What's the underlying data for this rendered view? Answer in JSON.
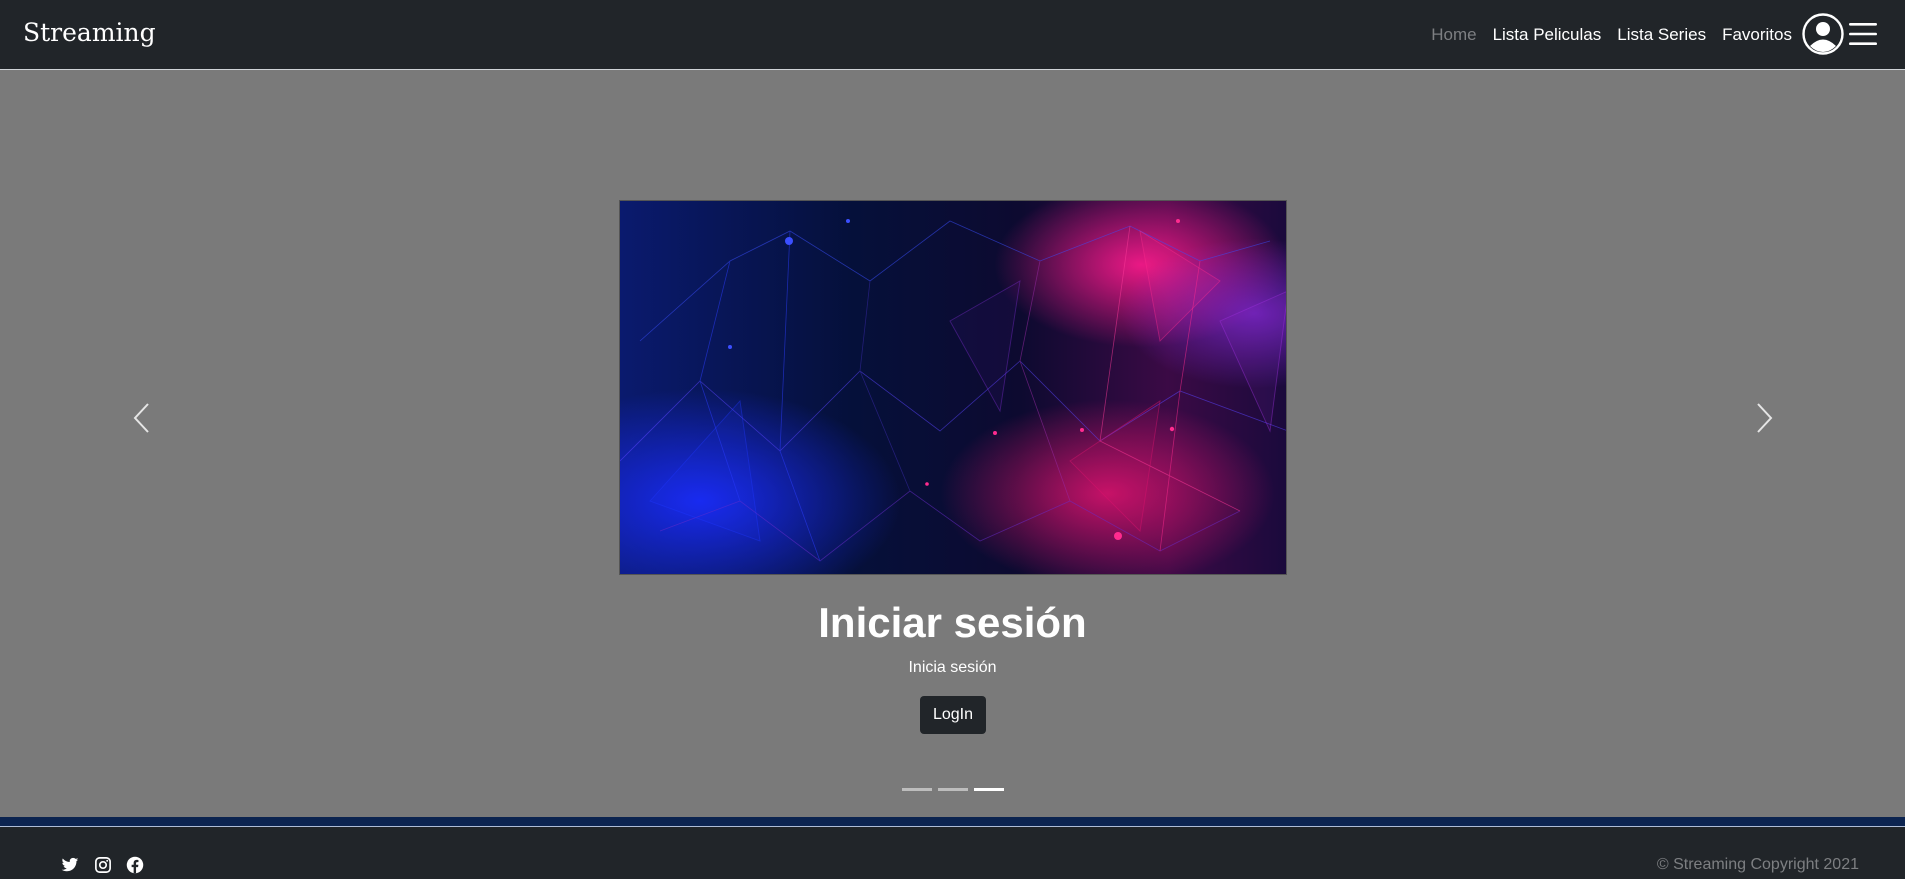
{
  "brand": "Streaming",
  "nav": {
    "items": [
      {
        "label": "Home",
        "active": true
      },
      {
        "label": "Lista Peliculas",
        "active": false
      },
      {
        "label": "Lista Series",
        "active": false
      },
      {
        "label": "Favoritos",
        "active": false
      }
    ],
    "user_icon": "user-circle-icon",
    "menu_icon": "hamburger-menu-icon"
  },
  "carousel": {
    "slide": {
      "title": "Iniciar sesión",
      "subtitle": "Inicia sesión",
      "button_label": "LogIn"
    },
    "prev_icon": "chevron-left-icon",
    "next_icon": "chevron-right-icon",
    "slide_count": 3,
    "active_index": 2
  },
  "footer": {
    "social_icons": [
      "twitter-icon",
      "instagram-icon",
      "facebook-icon"
    ],
    "copyright": "© Streaming Copyright 2021"
  },
  "colors": {
    "navbar_bg": "#212529",
    "page_bg": "#7a7a7a",
    "footer_strip": "#0c2450",
    "muted_text": "#7d7f82"
  }
}
